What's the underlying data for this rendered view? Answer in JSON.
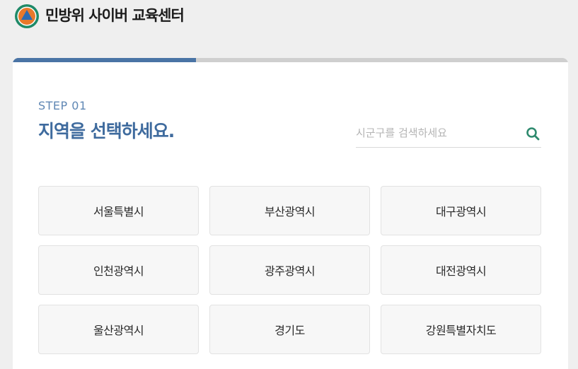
{
  "header": {
    "title": "민방위 사이버 교육센터",
    "logo_icon": "civil-defense-emblem-icon"
  },
  "progress": {
    "fraction": 0.33
  },
  "step": {
    "label": "STEP 01",
    "title": "지역을 선택하세요."
  },
  "search": {
    "placeholder": "시군구를 검색하세요",
    "value": "",
    "icon": "search-icon"
  },
  "regions": [
    "서울특별시",
    "부산광역시",
    "대구광역시",
    "인천광역시",
    "광주광역시",
    "대전광역시",
    "울산광역시",
    "경기도",
    "강원특별자치도"
  ],
  "colors": {
    "accent": "#4a74a5",
    "title": "#3f6b9e",
    "search_icon": "#2e8a6e",
    "logo_orange": "#e8792b",
    "logo_green": "#1f8a68",
    "logo_blue": "#2b6bb3"
  }
}
